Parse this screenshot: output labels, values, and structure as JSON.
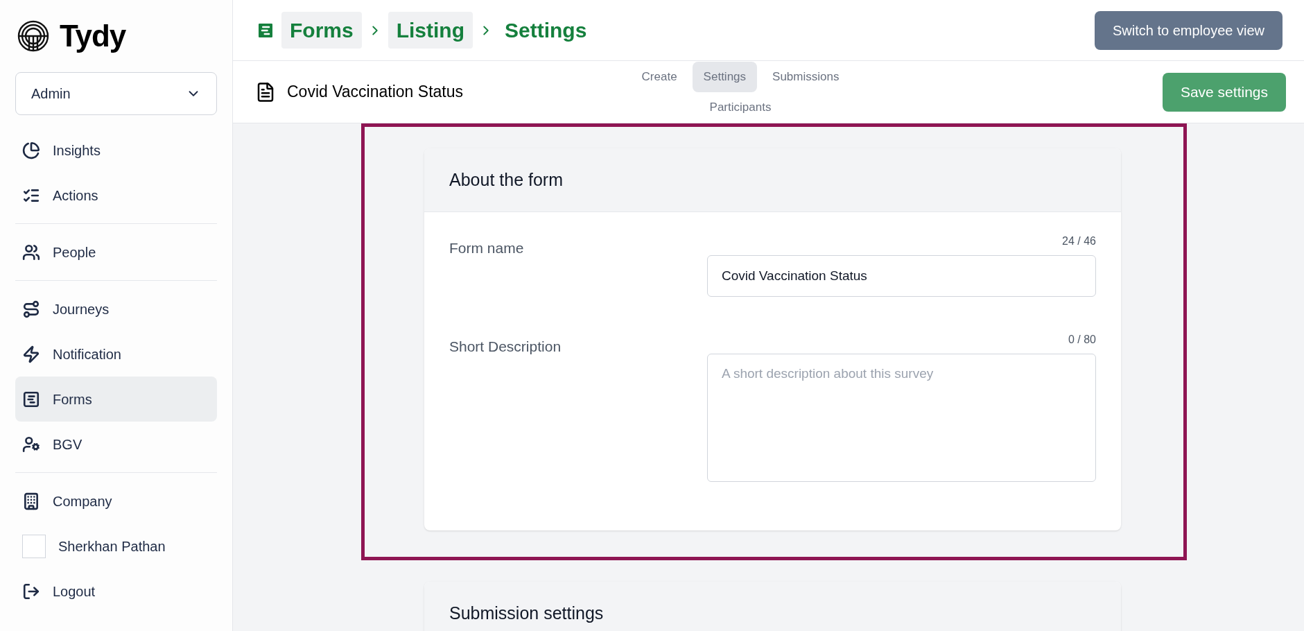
{
  "sidebar": {
    "brand": "Tydy",
    "role_select": {
      "value": "Admin"
    },
    "sections": [
      {
        "items": [
          {
            "label": "Insights",
            "selected": false
          },
          {
            "label": "Actions",
            "selected": false
          }
        ]
      },
      {
        "items": [
          {
            "label": "People",
            "selected": false
          }
        ]
      },
      {
        "items": [
          {
            "label": "Journeys",
            "selected": false
          },
          {
            "label": "Notification",
            "selected": false
          },
          {
            "label": "Forms",
            "selected": true
          },
          {
            "label": "BGV",
            "selected": false
          }
        ]
      },
      {
        "items": [
          {
            "label": "Company",
            "selected": false
          },
          {
            "label": "Sherkhan Pathan",
            "selected": false
          },
          {
            "label": "Logout",
            "selected": false
          }
        ]
      }
    ]
  },
  "breadcrumb": [
    {
      "label": "Forms",
      "link": true
    },
    {
      "label": "Listing",
      "link": true
    },
    {
      "label": "Settings",
      "link": false
    }
  ],
  "switch_button": "Switch to employee view",
  "form_title": "Covid Vaccination Status",
  "tabs": [
    {
      "label": "Create",
      "selected": false
    },
    {
      "label": "Settings",
      "selected": true
    },
    {
      "label": "Submissions",
      "selected": false
    },
    {
      "label": "Participants",
      "selected": false
    }
  ],
  "save_button": "Save settings",
  "cards": [
    {
      "title": "About the form",
      "fields": [
        {
          "kind": "input",
          "label": "Form name",
          "counter": "24 / 46",
          "value": "Covid Vaccination Status"
        },
        {
          "kind": "textarea",
          "label": "Short Description",
          "counter": "0 / 80",
          "placeholder": "A short description about this survey"
        }
      ]
    },
    {
      "title": "Submission settings"
    }
  ]
}
